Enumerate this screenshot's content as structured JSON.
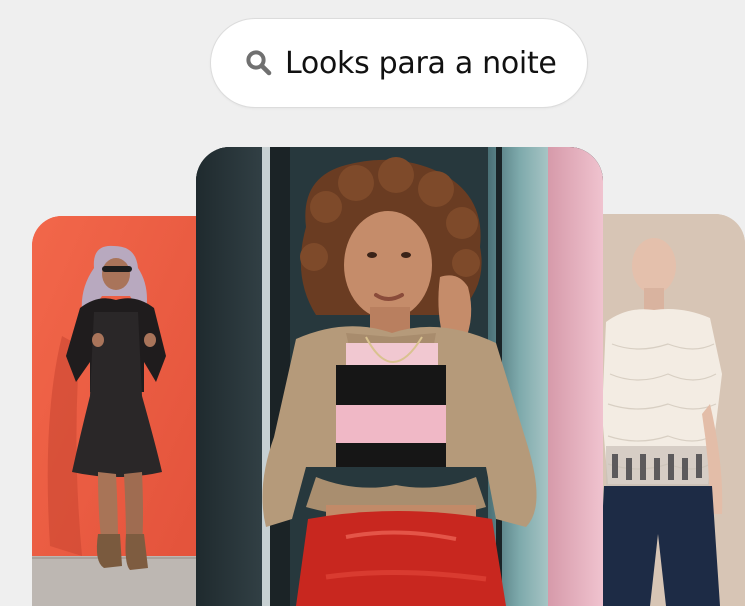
{
  "search": {
    "query": "Looks para a noite",
    "icon": "search-icon"
  },
  "colors": {
    "page_background": "#efefef",
    "pill_background": "#ffffff",
    "left_card_background": "#ee5c40",
    "right_card_background": "#d6c4b4"
  }
}
